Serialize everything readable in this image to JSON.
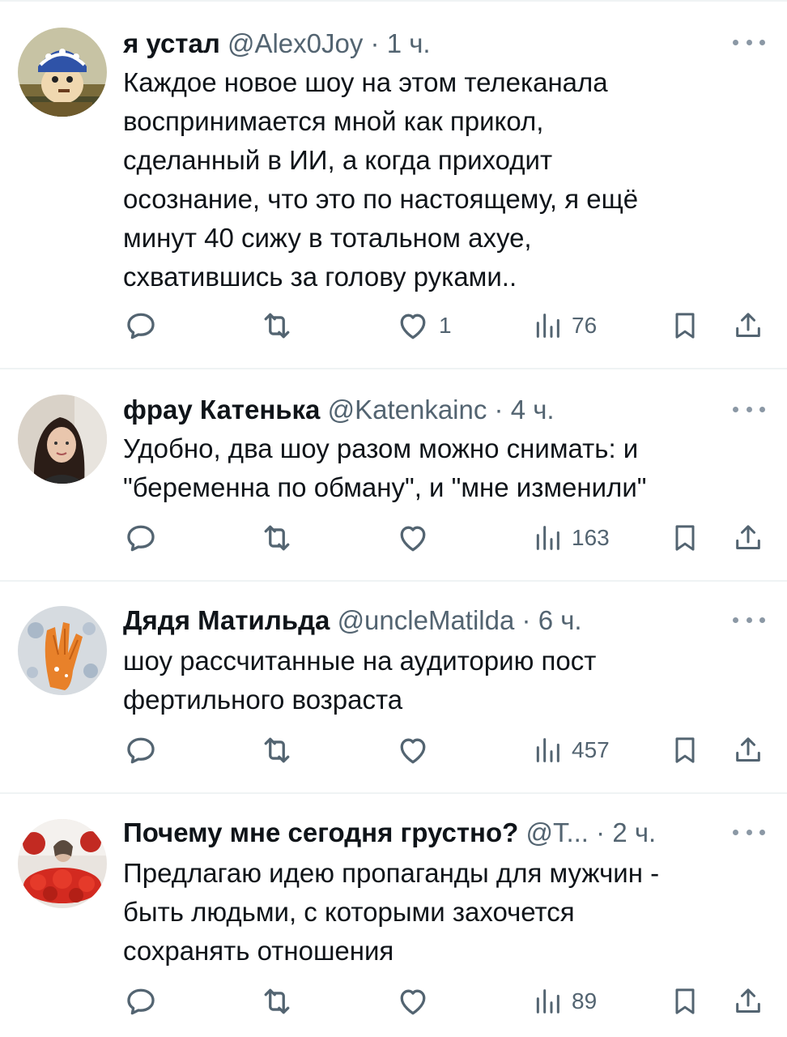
{
  "tweets": [
    {
      "name": "я устал",
      "handle": "@Alex0Joy",
      "dot": "·",
      "time": "1 ч.",
      "lines": [
        "Каждое новое шоу на этом телеканала",
        "воспринимается мной как прикол,",
        "сделанный в ИИ, а когда приходит",
        "осознание, что это по настоящему, я ещё",
        "минут 40 сижу в тотальном ахуе,",
        "схватившись за голову руками.."
      ],
      "likes": "1",
      "views": "76"
    },
    {
      "name": "фрау Катенька",
      "handle": "@Katenkainc",
      "dot": "·",
      "time": "4 ч.",
      "lines": [
        "Удобно, два шоу разом можно снимать: и",
        "\"беременна по обману\", и \"мне изменили\""
      ],
      "likes": "",
      "views": "163"
    },
    {
      "name": "Дядя Матильда",
      "handle": "@uncleMatilda",
      "dot": "·",
      "time": "6 ч.",
      "lines": [
        "шоу рассчитанные на аудиторию пост",
        "фертильного возраста"
      ],
      "likes": "",
      "views": "457"
    },
    {
      "name": "Почему мне сегодня грустно?",
      "handle": "@T...",
      "dot": "·",
      "time": "2 ч.",
      "lines": [
        "Предлагаю идею пропаганды для мужчин -",
        "быть людьми, с которыми захочется",
        "сохранять отношения"
      ],
      "likes": "",
      "views": "89"
    }
  ],
  "icons": {
    "reply": "reply-icon",
    "retweet": "retweet-icon",
    "like": "heart-icon",
    "views": "views-icon",
    "bookmark": "bookmark-icon",
    "share": "share-icon",
    "more": "more-icon"
  },
  "colors": {
    "text": "#0f1419",
    "secondary": "#536471",
    "divider": "#eff3f4"
  }
}
